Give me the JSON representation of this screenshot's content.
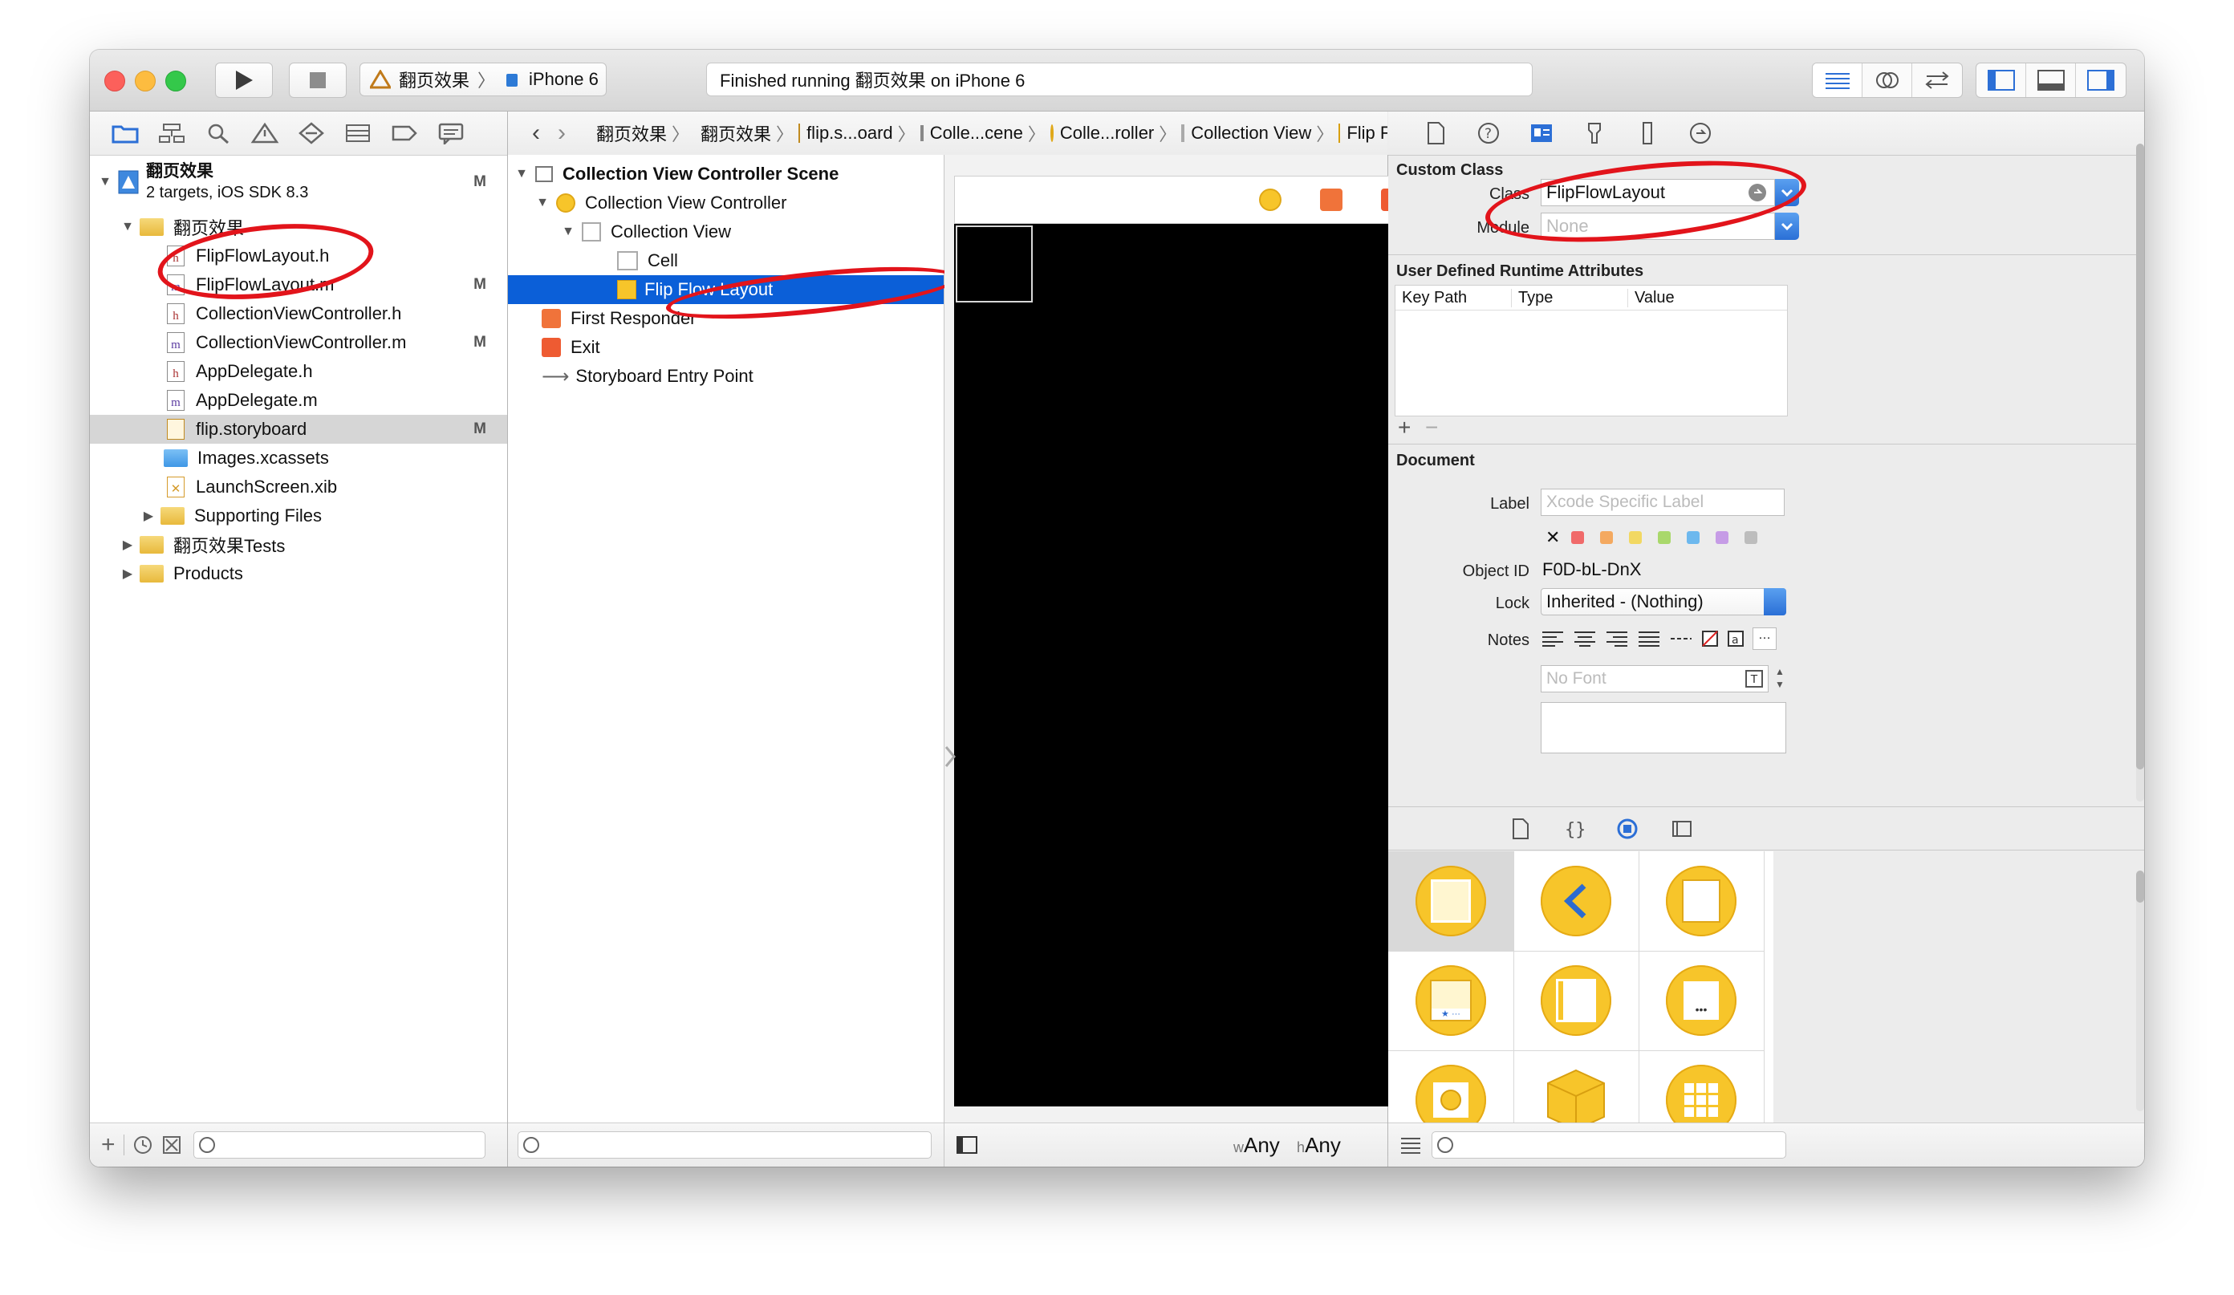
{
  "toolbar": {
    "scheme_target": "翻页效果",
    "scheme_device": "iPhone 6",
    "status": "Finished running 翻页效果 on iPhone 6"
  },
  "navigator": {
    "project": {
      "name": "翻页效果",
      "subtitle": "2 targets, iOS SDK 8.3",
      "mark": "M"
    },
    "group": "翻页效果",
    "files": [
      {
        "name": "FlipFlowLayout.h",
        "type": "h",
        "mark": ""
      },
      {
        "name": "FlipFlowLayout.m",
        "type": "m",
        "mark": "M"
      },
      {
        "name": "CollectionViewController.h",
        "type": "h",
        "mark": ""
      },
      {
        "name": "CollectionViewController.m",
        "type": "m",
        "mark": "M"
      },
      {
        "name": "AppDelegate.h",
        "type": "h",
        "mark": ""
      },
      {
        "name": "AppDelegate.m",
        "type": "m",
        "mark": ""
      },
      {
        "name": "flip.storyboard",
        "type": "storyboard",
        "mark": "M"
      },
      {
        "name": "Images.xcassets",
        "type": "assets",
        "mark": ""
      },
      {
        "name": "LaunchScreen.xib",
        "type": "xib",
        "mark": ""
      }
    ],
    "supporting": "Supporting Files",
    "tests": "翻页效果Tests",
    "products": "Products"
  },
  "jumpbar": {
    "items": [
      "翻页效果",
      "翻页效果",
      "flip.s...oard",
      "Colle...cene",
      "Colle...roller",
      "Collection View",
      "Flip Flow Layout"
    ]
  },
  "outline": {
    "scene": "Collection View Controller Scene",
    "controller": "Collection View Controller",
    "collection_view": "Collection View",
    "cell": "Cell",
    "layout": "Flip Flow Layout",
    "first_responder": "First Responder",
    "exit": "Exit",
    "entry": "Storyboard Entry Point"
  },
  "canvas": {
    "size_w": "Any",
    "size_h": "Any",
    "w_prefix": "w",
    "h_prefix": "h"
  },
  "inspector": {
    "custom_class_title": "Custom Class",
    "class_label": "Class",
    "class_value": "FlipFlowLayout",
    "module_label": "Module",
    "module_placeholder": "None",
    "runtime_title": "User Defined Runtime Attributes",
    "col_key": "Key Path",
    "col_type": "Type",
    "col_value": "Value",
    "document_title": "Document",
    "label_label": "Label",
    "label_placeholder": "Xcode Specific Label",
    "object_id_label": "Object ID",
    "object_id": "F0D-bL-DnX",
    "lock_label": "Lock",
    "lock_value": "Inherited - (Nothing)",
    "notes_label": "Notes",
    "font_placeholder": "No Font",
    "swatch_colors": [
      "#f06a6a",
      "#f4a960",
      "#f2d862",
      "#a9d86b",
      "#6db8ee",
      "#c69ce6",
      "#bdbdbd"
    ]
  }
}
